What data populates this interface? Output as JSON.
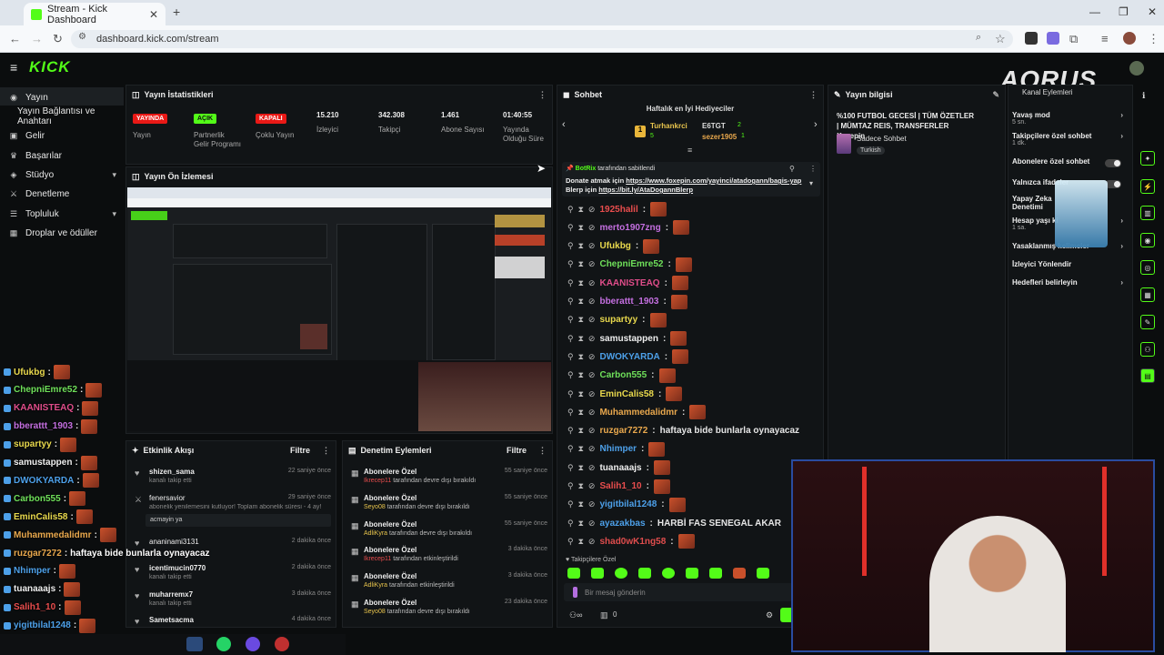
{
  "browser": {
    "tab_title": "Stream - Kick Dashboard",
    "url": "dashboard.kick.com/stream"
  },
  "app": {
    "logo": "KICK",
    "overlay_brand": "AORUS"
  },
  "sidebar": {
    "items": [
      {
        "label": "Yayın",
        "icon": "broadcast-icon"
      },
      {
        "label": "Yayın Bağlantısı ve Anahtarı",
        "icon": ""
      },
      {
        "label": "Gelir",
        "icon": "wallet-icon"
      },
      {
        "label": "Başarılar",
        "icon": "trophy-icon"
      },
      {
        "label": "Stüdyo",
        "icon": "studio-icon"
      },
      {
        "label": "Denetleme",
        "icon": "sword-icon"
      },
      {
        "label": "Topluluk",
        "icon": "community-icon"
      },
      {
        "label": "Droplar ve ödüller",
        "icon": "gift-icon"
      }
    ]
  },
  "stats": {
    "title": "Yayın İstatistikleri",
    "items": [
      {
        "badge": "YAYINDA",
        "label": "Yayın",
        "color": "#e91916"
      },
      {
        "badge": "AÇIK",
        "label": "Partnerlik Gelir Programı",
        "color": "#53fc18"
      },
      {
        "badge": "KAPALI",
        "label": "Çoklu Yayın",
        "color": "#e91916"
      },
      {
        "value": "15.210",
        "label": "İzleyici"
      },
      {
        "value": "342.308",
        "label": "Takipçi"
      },
      {
        "value": "1.461",
        "label": "Abone Sayısı"
      },
      {
        "value": "01:40:55",
        "label": "Yayında Olduğu Süre"
      }
    ]
  },
  "preview": {
    "title": "Yayın Ön İzlemesi"
  },
  "activity": {
    "title": "Etkinlik Akışı",
    "filter": "Filtre",
    "items": [
      {
        "name": "shizen_sama",
        "sub": "kanalı takip etti",
        "time": "22 saniye önce"
      },
      {
        "name": "fenersavior",
        "sub": "abonelik yenilemesini kutluyor! Toplam abonelik süresi - 4 ay!",
        "time": "29 saniye önce"
      },
      {
        "name": "",
        "sub": "acmayin ya",
        "time": ""
      },
      {
        "name": "ananinami3131",
        "sub": "",
        "time": "2 dakika önce"
      },
      {
        "name": "icentimucin0770",
        "sub": "kanalı takip etti",
        "time": "2 dakika önce"
      },
      {
        "name": "muharremx7",
        "sub": "kanalı takip etti",
        "time": "3 dakika önce"
      },
      {
        "name": "Sametsacma",
        "sub": "",
        "time": "4 dakika önce"
      }
    ]
  },
  "moderation": {
    "title": "Denetim Eylemleri",
    "filter": "Filtre",
    "items": [
      {
        "name": "Abonelere Özel",
        "user": "Ikrecep11",
        "action": "tarafından devre dışı bırakıldı",
        "time": "55 saniye önce",
        "color": "#e94d4d"
      },
      {
        "name": "Abonelere Özel",
        "user": "Seyo08",
        "action": "tarafından devre dışı bırakıldı",
        "time": "55 saniye önce",
        "color": "#e9c54d"
      },
      {
        "name": "Abonelere Özel",
        "user": "AdliKyra",
        "action": "tarafından devre dışı bırakıldı",
        "time": "55 saniye önce",
        "color": "#e9c54d"
      },
      {
        "name": "Abonelere Özel",
        "user": "Ikrecep11",
        "action": "tarafından etkinleştirildi",
        "time": "3 dakika önce",
        "color": "#e94d4d"
      },
      {
        "name": "Abonelere Özel",
        "user": "AdliKyra",
        "action": "tarafından etkinleştirildi",
        "time": "3 dakika önce",
        "color": "#e9c54d"
      },
      {
        "name": "Abonelere Özel",
        "user": "Seyo08",
        "action": "tarafından devre dışı bırakıldı",
        "time": "23 dakika önce",
        "color": "#e9c54d"
      }
    ]
  },
  "chat": {
    "title": "Sohbet",
    "gifters_title": "Haftalık en İyi Hediyeciler",
    "gifters": [
      {
        "name": "Turhankrci",
        "count": "5"
      },
      {
        "name": "E6TGT",
        "count": "2"
      },
      {
        "name": "sezer1905",
        "count": "1"
      }
    ],
    "pinned_by": "BotRix",
    "pinned_suffix": "tarafından sabitlendi",
    "pinned_line1": "Donate atmak için",
    "pinned_link1": "https://www.foxepin.com/yayinci/atadogann/bagis-yap",
    "pinned_line2": "Blerp için",
    "pinned_link2": "https://bit.ly/AtaDogannBlerp",
    "messages": [
      {
        "user": "1925halil",
        "color": "#e94d4d",
        "text": ""
      },
      {
        "user": "merto1907zng",
        "color": "#c46fe0",
        "text": ""
      },
      {
        "user": "Ufukbg",
        "color": "#e9d94d",
        "text": ""
      },
      {
        "user": "ChepniEmre52",
        "color": "#6fe05a",
        "text": ""
      },
      {
        "user": "KAANISTEAQ",
        "color": "#e04d8a",
        "text": ""
      },
      {
        "user": "bberattt_1903",
        "color": "#c46fe0",
        "text": ""
      },
      {
        "user": "supartyy",
        "color": "#e9d94d",
        "text": ""
      },
      {
        "user": "samustappen",
        "color": "#eeeeee",
        "text": ""
      },
      {
        "user": "DWOKYARDA",
        "color": "#4da0e9",
        "text": ""
      },
      {
        "user": "Carbon555",
        "color": "#6fe05a",
        "text": ""
      },
      {
        "user": "EminCalis58",
        "color": "#e9d94d",
        "text": ""
      },
      {
        "user": "Muhammedalidmr",
        "color": "#e9a84d",
        "text": ""
      },
      {
        "user": "ruzgar7272",
        "color": "#e9a84d",
        "text": "haftaya bide bunlarla oynayacaz"
      },
      {
        "user": "Nhimper",
        "color": "#4da0e9",
        "text": ""
      },
      {
        "user": "tuanaaajs",
        "color": "#eeeeee",
        "text": ""
      },
      {
        "user": "Salih1_10",
        "color": "#e94d4d",
        "text": ""
      },
      {
        "user": "yigitbilal1248",
        "color": "#4da0e9",
        "text": ""
      },
      {
        "user": "ayazakbas",
        "color": "#4da0e9",
        "text": "HARBİ FAS SENEGAL AKAR"
      },
      {
        "user": "shad0wK1ng58",
        "color": "#e04d4d",
        "text": ""
      }
    ],
    "followers_only": "Takipçilere Özel",
    "input_placeholder": "Bir mesaj gönderin",
    "count": "0"
  },
  "stream_info": {
    "title": "Yayın bilgisi",
    "stream_title": "%100 FUTBOL GECESİ | TÜM ÖZETLER | MÜMTAZ REIS, TRANSFERLER !foxepin",
    "category": "Sadece Sohbet",
    "tag": "Turkish"
  },
  "settings": {
    "header": "Kanal Eylemleri",
    "items": [
      {
        "label": "Yavaş mod",
        "sub": "5 sn.",
        "kind": "chev"
      },
      {
        "label": "Takipçilere özel sohbet",
        "sub": "1 dk.",
        "kind": "chev"
      },
      {
        "label": "Abonelere özel sohbet",
        "sub": "",
        "kind": "toggle"
      },
      {
        "label": "Yalnızca ifadeler",
        "sub": "",
        "kind": "toggle"
      },
      {
        "label": "Yapay Zeka Denetimi",
        "sub": "",
        "kind": "chev"
      },
      {
        "label": "Hesap yaşı ki",
        "sub": "1 sa.",
        "kind": "chev"
      },
      {
        "label": "Yasaklanmış kelimeler",
        "sub": "",
        "kind": "chev"
      },
      {
        "label": "İzleyici Yönlendir",
        "sub": "",
        "kind": "none"
      },
      {
        "label": "Hedefleri belirleyin",
        "sub": "",
        "kind": "chev"
      }
    ]
  },
  "overlay_chat": [
    {
      "user": "Ufukbg",
      "color": "#e9d94d",
      "text": ""
    },
    {
      "user": "ChepniEmre52",
      "color": "#6fe05a",
      "text": ""
    },
    {
      "user": "KAANISTEAQ",
      "color": "#e04d8a",
      "text": ""
    },
    {
      "user": "bberattt_1903",
      "color": "#c46fe0",
      "text": ""
    },
    {
      "user": "supartyy",
      "color": "#e9d94d",
      "text": ""
    },
    {
      "user": "samustappen",
      "color": "#eeeeee",
      "text": ""
    },
    {
      "user": "DWOKYARDA",
      "color": "#4da0e9",
      "text": ""
    },
    {
      "user": "Carbon555",
      "color": "#6fe05a",
      "text": ""
    },
    {
      "user": "EminCalis58",
      "color": "#e9d94d",
      "text": ""
    },
    {
      "user": "Muhammedalidmr",
      "color": "#e9a84d",
      "text": ""
    },
    {
      "user": "ruzgar7272",
      "color": "#e9a84d",
      "text": "haftaya bide bunlarla oynayacaz"
    },
    {
      "user": "Nhimper",
      "color": "#4da0e9",
      "text": ""
    },
    {
      "user": "tuanaaajs",
      "color": "#eeeeee",
      "text": ""
    },
    {
      "user": "Salih1_10",
      "color": "#e94d4d",
      "text": ""
    },
    {
      "user": "yigitbilal1248",
      "color": "#4da0e9",
      "text": ""
    },
    {
      "user": "ayazakbas",
      "color": "#4da0e9",
      "text": "HARBİ FAS SENEGAL AKAR"
    }
  ]
}
